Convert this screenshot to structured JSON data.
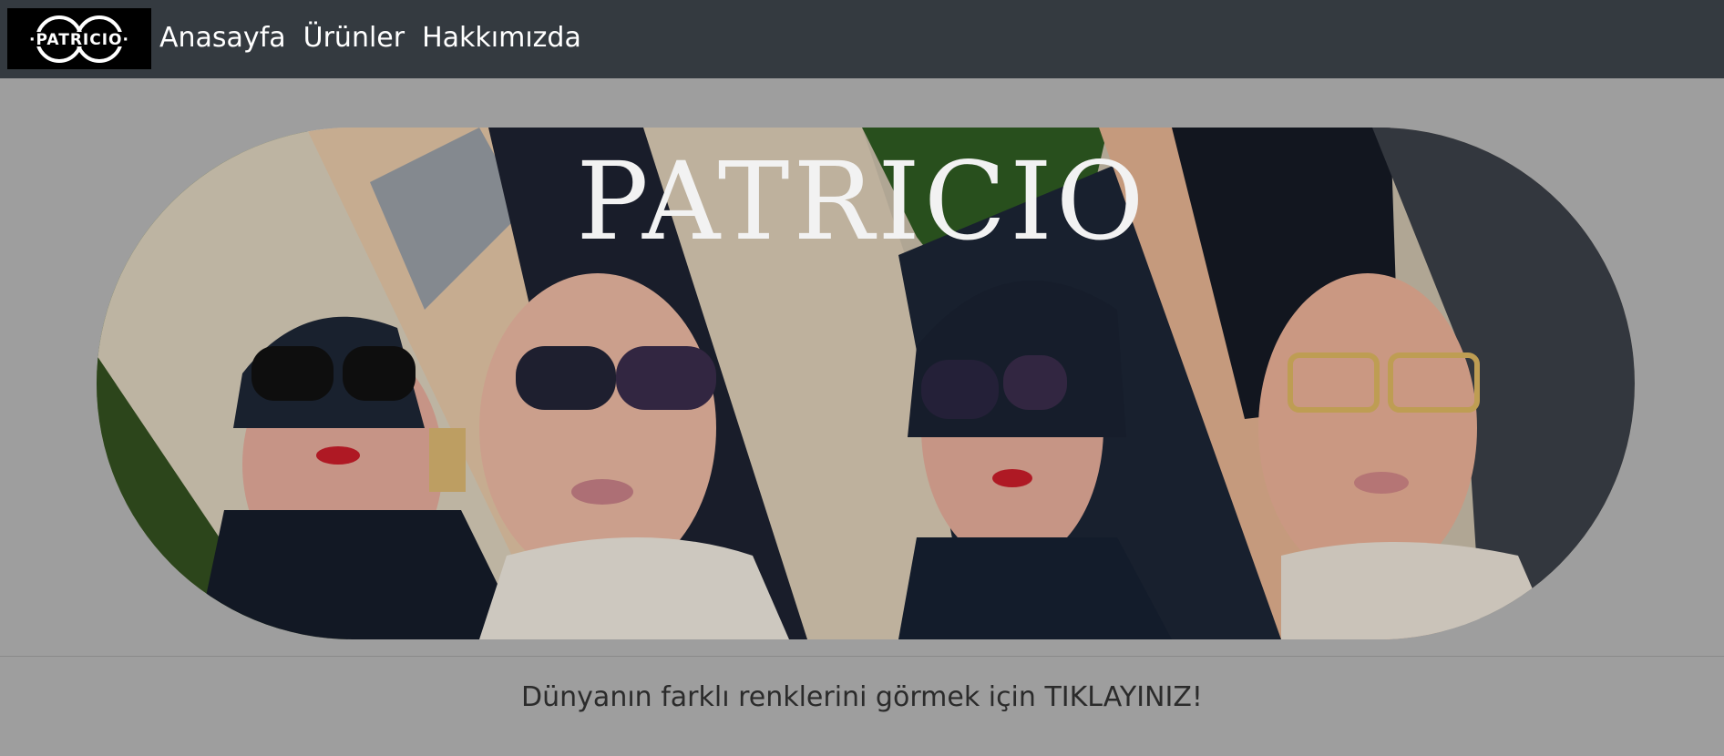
{
  "navbar": {
    "logo_text": "PATRICIO",
    "links": [
      {
        "label": "Anasayfa"
      },
      {
        "label": "Ürünler"
      },
      {
        "label": "Hakkımızda"
      }
    ],
    "background": "#343a40"
  },
  "hero": {
    "title": "PATRICIO",
    "image_icon": "sunglasses-collage-image"
  },
  "cta": {
    "text": "Dünyanın farklı renklerini görmek için TIKLAYINIZ!"
  },
  "colors": {
    "page_bg": "#9e9e9e",
    "navbar_bg": "#343a40",
    "nav_text": "#ffffff",
    "cta_text": "#2b2b2b"
  }
}
